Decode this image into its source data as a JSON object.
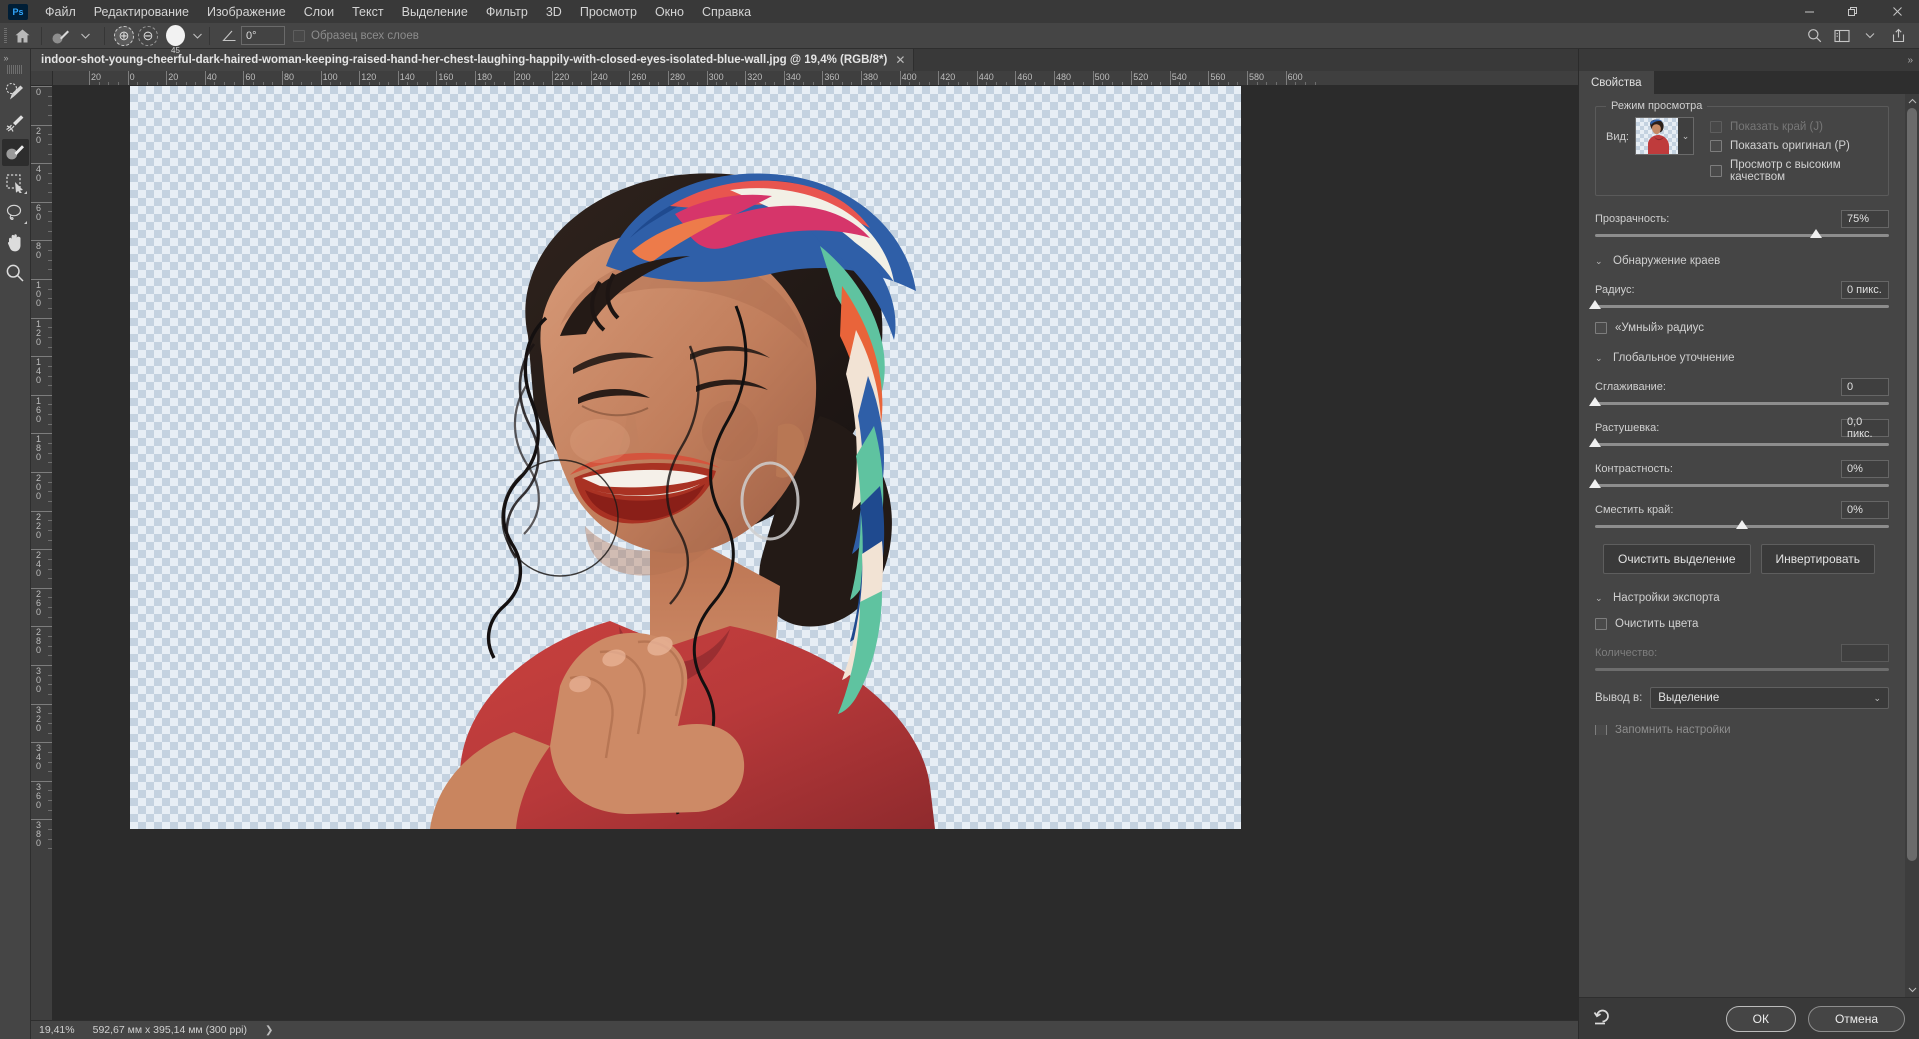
{
  "app": {
    "logo": "Ps"
  },
  "menubar": {
    "items": [
      {
        "label": "Файл"
      },
      {
        "label": "Редактирование"
      },
      {
        "label": "Изображение"
      },
      {
        "label": "Слои"
      },
      {
        "label": "Текст"
      },
      {
        "label": "Выделение"
      },
      {
        "label": "Фильтр"
      },
      {
        "label": "3D"
      },
      {
        "label": "Просмотр"
      },
      {
        "label": "Окно"
      },
      {
        "label": "Справка"
      }
    ],
    "window_controls": [
      {
        "name": "minimize",
        "glyph": "—"
      },
      {
        "name": "restore",
        "glyph": "❐"
      },
      {
        "name": "close",
        "glyph": "✕"
      }
    ]
  },
  "options_bar": {
    "home_icon": "home-icon",
    "brush_preset_icon": "brush-preset-icon",
    "add_mode_icon": "⊕",
    "subtract_mode_icon": "⊖",
    "brush_size": "45",
    "angle_icon": "angle-icon",
    "angle_value": "0°",
    "sample_all_layers_label": "Образец всех слоев",
    "right_icons": [
      {
        "name": "search-icon",
        "glyph": "⌕"
      },
      {
        "name": "workspace-icon",
        "glyph": "▥"
      },
      {
        "name": "chevron-down-icon",
        "glyph": "⌄"
      },
      {
        "name": "share-icon",
        "glyph": "⇪"
      }
    ]
  },
  "toolbar": {
    "collapse_glyph": "»",
    "tools": [
      {
        "name": "quick-selection-tool",
        "glyph": "quick-select"
      },
      {
        "name": "refine-edge-brush-tool",
        "glyph": "refine-brush"
      },
      {
        "name": "brush-tool",
        "glyph": "brush",
        "active": true
      },
      {
        "name": "object-selection-tool",
        "glyph": "object-select"
      },
      {
        "name": "lasso-tool",
        "glyph": "lasso"
      },
      {
        "name": "hand-tool",
        "glyph": "hand"
      },
      {
        "name": "zoom-tool",
        "glyph": "zoom"
      }
    ]
  },
  "document": {
    "tab_title": "indoor-shot-young-cheerful-dark-haired-woman-keeping-raised-hand-her-chest-laughing-happily-with-closed-eyes-isolated-blue-wall.jpg @ 19,4% (RGB/8*)",
    "close_glyph": "✕"
  },
  "rulers": {
    "horizontal": [
      "20",
      "0",
      "20",
      "40",
      "60",
      "80",
      "100",
      "120",
      "140",
      "160",
      "180",
      "200",
      "220",
      "240",
      "260",
      "280",
      "300",
      "320",
      "340",
      "360",
      "380",
      "400",
      "420",
      "440",
      "460",
      "480",
      "500",
      "520",
      "540",
      "560",
      "580",
      "600"
    ],
    "vertical": [
      "0",
      "20",
      "40",
      "60",
      "80",
      "100",
      "120",
      "140",
      "160",
      "180",
      "200",
      "220",
      "240",
      "260",
      "280",
      "300",
      "320",
      "340",
      "360",
      "380"
    ]
  },
  "status_bar": {
    "zoom": "19,41%",
    "dimensions": "592,67 мм x 395,14 мм (300 ppi)",
    "arrow": "❯"
  },
  "properties_panel": {
    "collapse_glyph": "»",
    "tab_label": "Свойства",
    "view_mode": {
      "legend": "Режим просмотра",
      "view_label": "Вид:",
      "dropdown_glyph": "⌄",
      "checkboxes": [
        {
          "label": "Показать край (J)",
          "checked": false,
          "disabled": true
        },
        {
          "label": "Показать оригинал (P)",
          "checked": false,
          "disabled": false
        },
        {
          "label": "Просмотр с высоким качеством",
          "checked": false,
          "disabled": false
        }
      ]
    },
    "opacity": {
      "label": "Прозрачность:",
      "value": "75%",
      "percent": 75
    },
    "edge_detection": {
      "title": "Обнаружение краев",
      "radius": {
        "label": "Радиус:",
        "value": "0 пикс.",
        "percent": 0
      },
      "smart_radius": {
        "label": "«Умный» радиус",
        "checked": false
      }
    },
    "global_refine": {
      "title": "Глобальное уточнение",
      "sliders": [
        {
          "label": "Сглаживание:",
          "value": "0",
          "percent": 0
        },
        {
          "label": "Растушевка:",
          "value": "0,0 пикс.",
          "percent": 0
        },
        {
          "label": "Контрастность:",
          "value": "0%",
          "percent": 0
        },
        {
          "label": "Сместить край:",
          "value": "0%",
          "percent": 50
        }
      ],
      "clear_selection_button": "Очистить выделение",
      "invert_button": "Инвертировать"
    },
    "export_settings": {
      "title": "Настройки экспорта",
      "decontaminate": {
        "label": "Очистить цвета",
        "checked": false
      },
      "amount": {
        "label": "Количество:",
        "value": "",
        "percent": 0,
        "disabled": true
      },
      "output_to": {
        "label": "Вывод в:",
        "value": "Выделение",
        "chevron": "⌄"
      },
      "remember_settings": {
        "label": "Запомнить настройки",
        "checked": false
      }
    },
    "footer": {
      "reset_icon": "reset-icon",
      "ok_button": "ОК",
      "cancel_button": "Отмена"
    }
  },
  "colors": {
    "menubar_bg": "#393939",
    "panel_bg": "#454545",
    "canvas_bg": "#2b2b2b",
    "checker_light": "#e7eef5",
    "checker_dark": "#c4d2e0",
    "text": "#d4d4d4"
  }
}
